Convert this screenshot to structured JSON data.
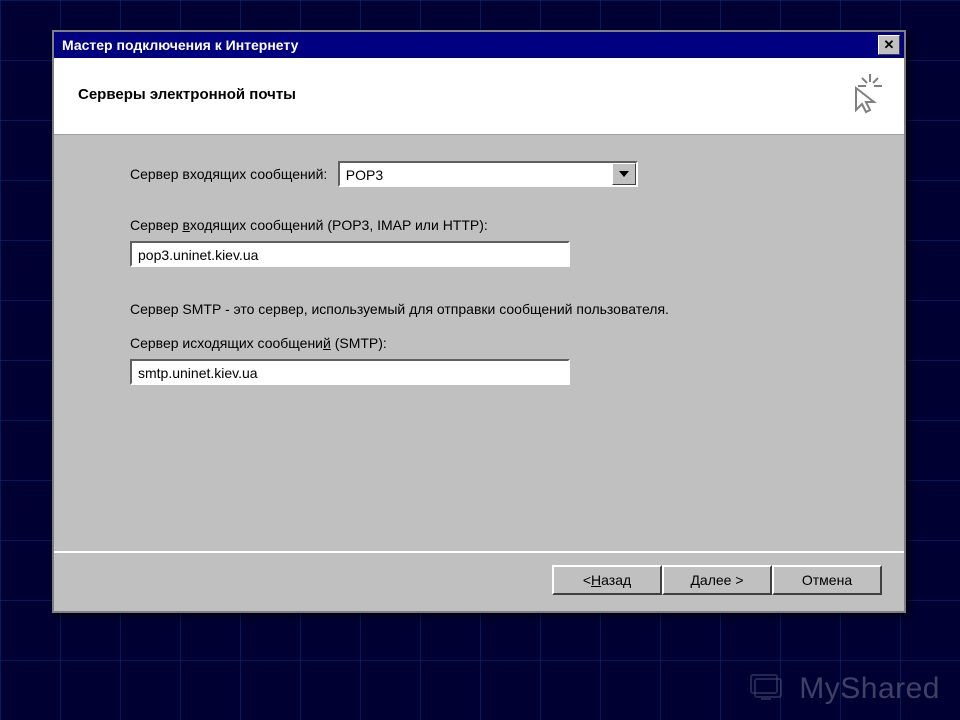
{
  "window": {
    "title": "Мастер подключения к Интернету"
  },
  "header": {
    "title": "Серверы электронной почты"
  },
  "form": {
    "incoming_type_label": "Сервер входящих сообщений:",
    "incoming_type_value": "POP3",
    "incoming_server_label_pre": "Сервер ",
    "incoming_server_label_u": "в",
    "incoming_server_label_post": "ходящих сообщений (POP3, IMAP или HTTP):",
    "incoming_server_value": "pop3.uninet.kiev.ua",
    "smtp_info": "Сервер SMTP - это сервер, используемый для отправки сообщений  пользователя.",
    "outgoing_server_label_pre": "Сервер исходящих сообщени",
    "outgoing_server_label_u": "й",
    "outgoing_server_label_post": " (SMTP):",
    "outgoing_server_value": "smtp.uninet.kiev.ua"
  },
  "buttons": {
    "back_pre": "< ",
    "back_u": "Н",
    "back_post": "азад",
    "next": "Далее >",
    "cancel": "Отмена"
  },
  "watermark": {
    "text": "MyShared"
  }
}
